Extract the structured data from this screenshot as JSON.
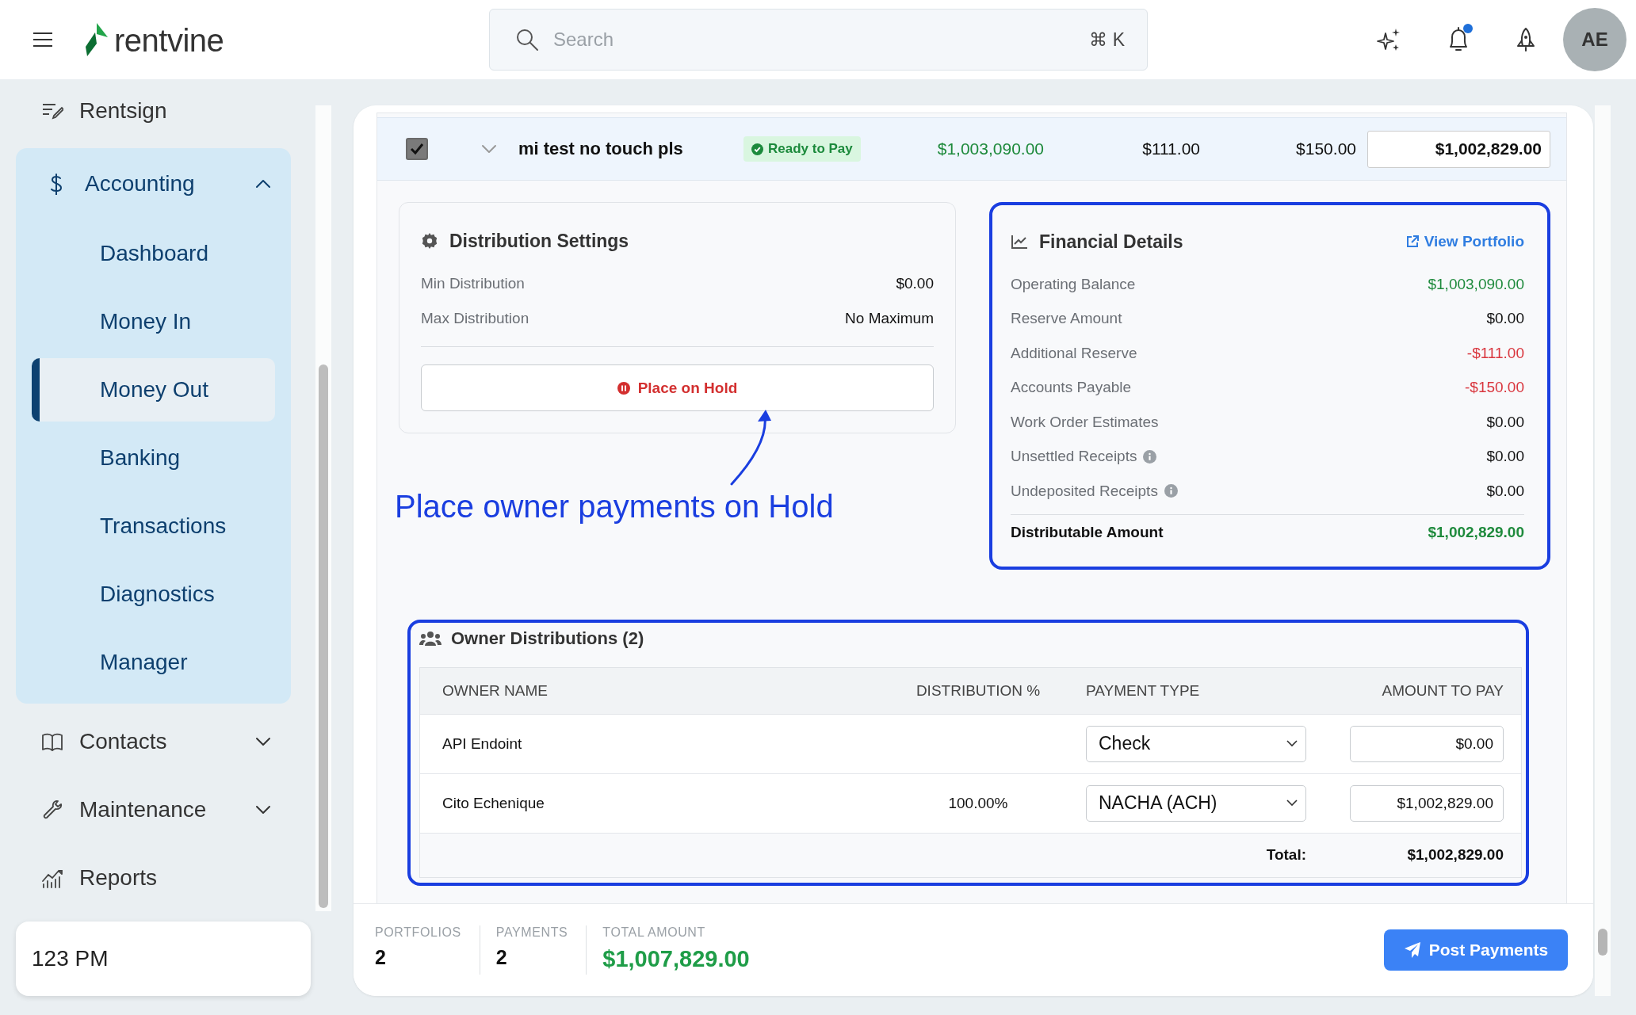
{
  "header": {
    "brand": "rentvine",
    "search": {
      "placeholder": "Search",
      "shortcut": "⌘ K"
    },
    "notifications_unread": true,
    "avatar": "AE"
  },
  "sidebar": {
    "items": [
      {
        "kind": "link",
        "label": "Rentsign"
      },
      {
        "kind": "group",
        "label": "Accounting",
        "expanded": true,
        "children": [
          {
            "label": "Dashboard",
            "selected": false
          },
          {
            "label": "Money In",
            "selected": false
          },
          {
            "label": "Money Out",
            "selected": true
          },
          {
            "label": "Banking",
            "selected": false
          },
          {
            "label": "Transactions",
            "selected": false
          },
          {
            "label": "Diagnostics",
            "selected": false
          },
          {
            "label": "Manager",
            "selected": false
          }
        ]
      },
      {
        "kind": "group",
        "label": "Contacts",
        "expanded": false
      },
      {
        "kind": "group",
        "label": "Maintenance",
        "expanded": false
      },
      {
        "kind": "link",
        "label": "Reports"
      }
    ],
    "footer": "123 PM"
  },
  "portfolio_row": {
    "checked": true,
    "expanded": true,
    "name": "mi test no touch pls",
    "status": "Ready to Pay",
    "values": [
      {
        "text": "$1,003,090.00",
        "color": "#1e8a3c"
      },
      {
        "text": "$111.00",
        "color": "#111111"
      },
      {
        "text": "$150.00",
        "color": "#111111"
      }
    ],
    "amount": "$1,002,829.00"
  },
  "distribution_settings": {
    "highlighted": false,
    "title": "Distribution Settings",
    "rows": [
      {
        "label": "Min Distribution",
        "value": "$0.00"
      },
      {
        "label": "Max Distribution",
        "value": "No Maximum"
      }
    ],
    "hold_button": "Place on Hold"
  },
  "annotation": "Place owner payments on Hold",
  "financial_details": {
    "highlighted": true,
    "title": "Financial Details",
    "link": "View Portfolio",
    "rows": [
      {
        "label": "Operating Balance",
        "value": "$1,003,090.00",
        "color": "#1e8a3c",
        "info": false
      },
      {
        "label": "Reserve Amount",
        "value": "$0.00",
        "color": "#111111",
        "info": false
      },
      {
        "label": "Additional Reserve",
        "value": "-$111.00",
        "color": "#d9363e",
        "info": false
      },
      {
        "label": "Accounts Payable",
        "value": "-$150.00",
        "color": "#d9363e",
        "info": false
      },
      {
        "label": "Work Order Estimates",
        "value": "$0.00",
        "color": "#111111",
        "info": false
      },
      {
        "label": "Unsettled Receipts",
        "value": "$0.00",
        "color": "#111111",
        "info": true
      },
      {
        "label": "Undeposited Receipts",
        "value": "$0.00",
        "color": "#111111",
        "info": true
      }
    ],
    "total": {
      "label": "Distributable Amount",
      "value": "$1,002,829.00"
    }
  },
  "owner_distributions": {
    "highlighted": true,
    "title": "Owner Distributions (2)",
    "columns": [
      "OWNER NAME",
      "DISTRIBUTION %",
      "PAYMENT TYPE",
      "AMOUNT TO PAY"
    ],
    "rows": [
      {
        "owner": "API Endoint",
        "payment_type": "Check",
        "amount": "$0.00"
      },
      {
        "owner": "Cito Echenique",
        "percent": "100.00%",
        "payment_type": "NACHA (ACH)",
        "amount": "$1,002,829.00"
      }
    ],
    "total_label": "Total:",
    "total": "$1,002,829.00"
  },
  "footer": {
    "stats": [
      {
        "label": "PORTFOLIOS",
        "value": "2"
      },
      {
        "label": "PAYMENTS",
        "value": "2"
      }
    ],
    "total": {
      "label": "TOTAL AMOUNT",
      "value": "$1,007,829.00"
    },
    "button": "Post Payments"
  }
}
